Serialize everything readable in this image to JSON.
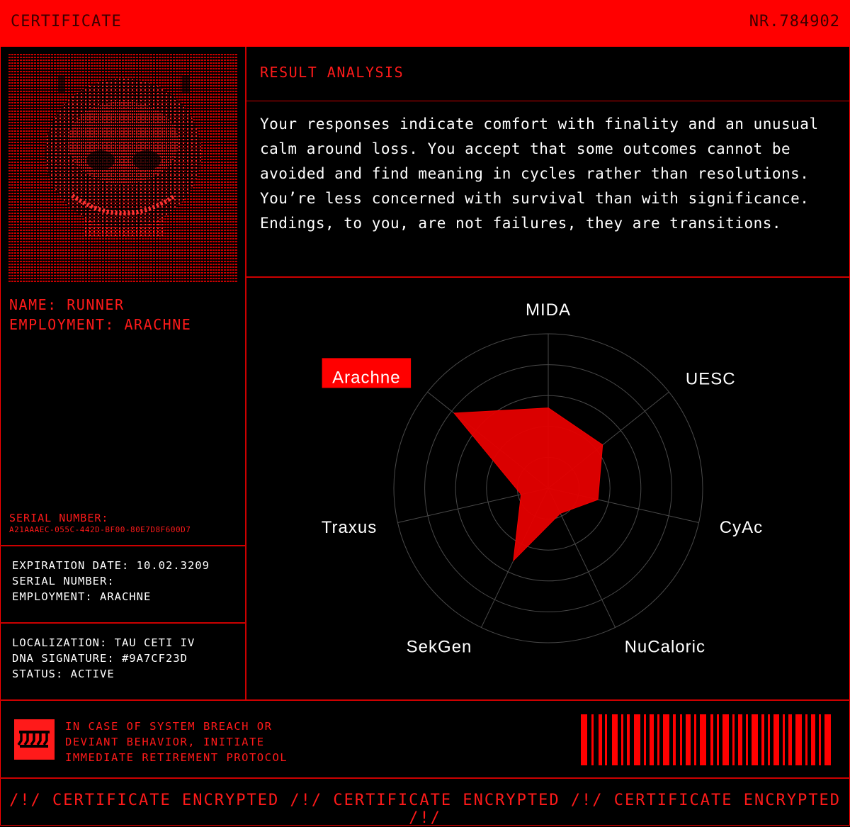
{
  "header": {
    "title": "CERTIFICATE",
    "number": "NR.784902"
  },
  "identity": {
    "name_line": "NAME: RUNNER",
    "employment_line": "EMPLOYMENT: ARACHNE",
    "serial_label": "SERIAL NUMBER:",
    "serial_value": "A21AAAEC-055C-442D-BF00-80E7D8F600D7"
  },
  "details_1": {
    "expiration": "EXPIRATION DATE: 10.02.3209",
    "serial": "SERIAL NUMBER:",
    "employment": "EMPLOYMENT: ARACHNE"
  },
  "details_2": {
    "localization": "LOCALIZATION: TAU CETI IV",
    "dna": "DNA SIGNATURE: #9A7CF23D",
    "status": "STATUS: ACTIVE"
  },
  "analysis": {
    "title": "RESULT ANALYSIS",
    "text": "Your responses indicate comfort with finality and an unusual calm around loss. You accept that some outcomes cannot be avoided and find meaning in cycles rather than resolutions. You’re less concerned with survival than with significance. Endings, to you, are not failures, they are transitions."
  },
  "radar": {
    "axes": [
      "MIDA",
      "UESC",
      "CyAc",
      "NuCaloric",
      "SekGen",
      "Traxus",
      "Arachne"
    ],
    "values": [
      0.52,
      0.45,
      0.33,
      0.18,
      0.52,
      0.18,
      0.78
    ],
    "highlight": "Arachne",
    "rings": 5
  },
  "warning": {
    "line1": "IN CASE OF SYSTEM BREACH OR",
    "line2": "DEVIANT BEHAVIOR, INITIATE",
    "line3": "IMMEDIATE RETIREMENT PROTOCOL",
    "icon": "retirement-protocol-icon"
  },
  "footer": {
    "text": "/!/ CERTIFICATE ENCRYPTED /!/ CERTIFICATE ENCRYPTED /!/ CERTIFICATE ENCRYPTED /!/"
  },
  "colors": {
    "accent": "#ff0000",
    "background": "#000000",
    "text": "#ffffff"
  }
}
